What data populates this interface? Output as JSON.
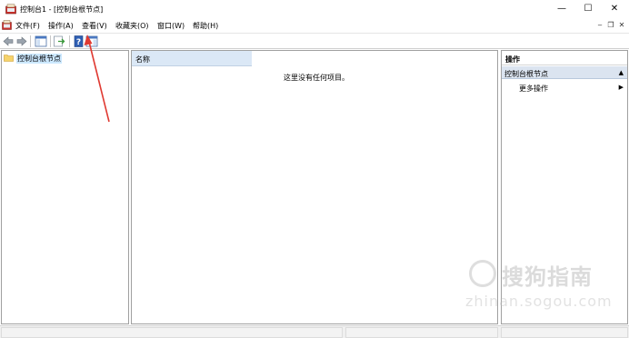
{
  "window": {
    "title": "控制台1 - [控制台根节点]",
    "controls": {
      "minimize": "—",
      "maximize": "☐",
      "close": "✕"
    }
  },
  "menubar": {
    "items": [
      "文件(F)",
      "操作(A)",
      "查看(V)",
      "收藏夹(O)",
      "窗口(W)",
      "帮助(H)"
    ],
    "mdi_controls": {
      "minimize": "‒",
      "restore": "❐",
      "close": "✕"
    }
  },
  "toolbar": {
    "buttons": [
      "back-icon",
      "forward-icon",
      "show-hide-tree-icon",
      "export-list-icon",
      "help-icon",
      "action-pane-icon"
    ]
  },
  "tree": {
    "root_label": "控制台根节点"
  },
  "center": {
    "column_header": "名称",
    "empty_message": "这里没有任何项目。"
  },
  "actions_pane": {
    "title": "操作",
    "section_label": "控制台根节点",
    "section_caret": "▲",
    "more_actions_label": "更多操作",
    "more_actions_caret": "▶"
  },
  "watermark": {
    "brand": "搜狗指南",
    "url": "zhinan.sogou.com"
  },
  "colors": {
    "accent_header": "#dbe8f6",
    "selection": "#cce8ff",
    "arrow": "#e03a32"
  }
}
